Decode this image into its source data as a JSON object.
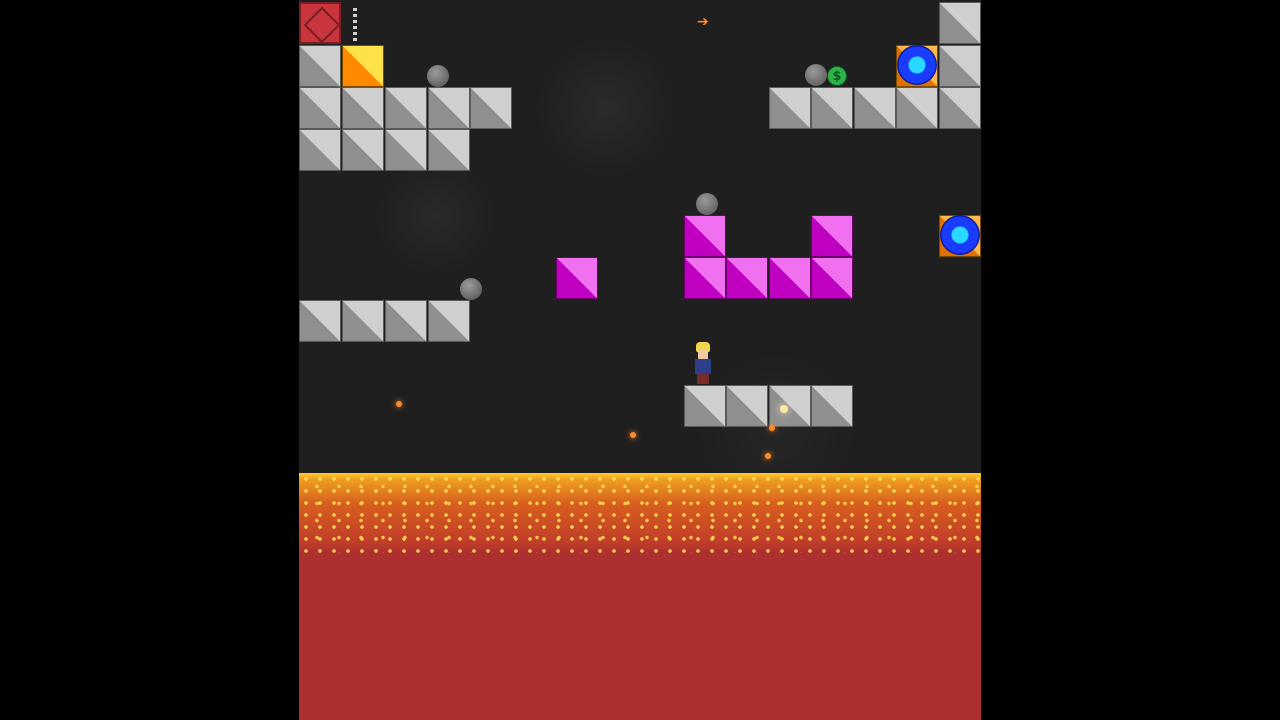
{
  "game": {
    "scene": "cave-level",
    "hazard": "lava",
    "colors": {
      "background": "#1f1f1f",
      "stone_block": "#bdbdbd",
      "pink_block": "#e04de0",
      "orange_block": "#ffb020",
      "lava_top": "#ffcc33",
      "lava_body": "#ad3030",
      "portal": "#1a3cff"
    },
    "icons": {
      "player": "player-character-icon",
      "coin": "dollar-coin-icon",
      "portal": "blue-portal-icon",
      "crate": "red-crate-icon",
      "arrow": "arrow-right-icon",
      "boulder": "boulder-icon"
    },
    "coin_symbol": "$",
    "arrow_symbol": "➔"
  }
}
